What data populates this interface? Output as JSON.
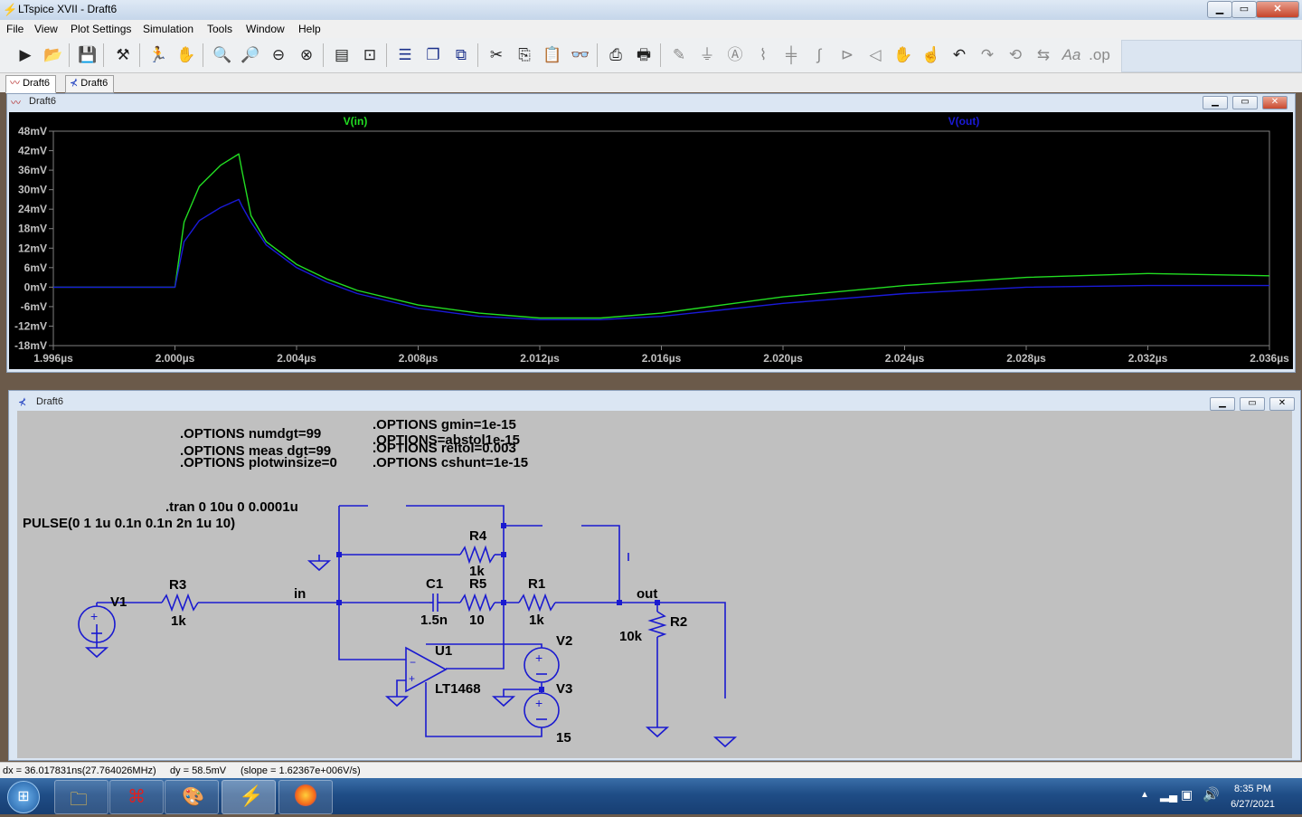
{
  "window": {
    "title": "LTspice XVII - Draft6",
    "min": "▁",
    "max": "▭",
    "close": "✕"
  },
  "menu": [
    "File",
    "View",
    "Plot Settings",
    "Simulation",
    "Tools",
    "Window",
    "Help"
  ],
  "toolbar_icons": [
    "run-icon",
    "open-icon",
    "save-icon",
    "control-panel-icon",
    "halt-icon",
    "pan-icon",
    "zoom-in-icon",
    "zoom-area-icon",
    "zoom-out-icon",
    "zoom-fit-icon",
    "autorange-icon",
    "mark-icon",
    "tile-horizontal-icon",
    "tile-vertical-icon",
    "cascade-icon",
    "cut-icon",
    "copy-icon",
    "paste-icon",
    "find-icon",
    "print-icon",
    "print-setup-icon",
    "wire-icon",
    "ground-icon",
    "label-icon",
    "resistor-icon",
    "capacitor-icon",
    "inductor-icon",
    "diode-icon",
    "component-icon",
    "move-icon",
    "drag-icon",
    "undo-icon",
    "redo-icon",
    "rotate-icon",
    "mirror-icon",
    "text-icon",
    "spice-directive-icon"
  ],
  "tabs": [
    {
      "label": "Draft6",
      "active": true
    },
    {
      "label": "Draft6",
      "active": false
    }
  ],
  "plot_window": {
    "title": "Draft6"
  },
  "schematic_window": {
    "title": "Draft6"
  },
  "chart_data": {
    "type": "line",
    "title": "",
    "xlabel": "",
    "ylabel": "",
    "background": "#000000",
    "xlim_us": [
      1.996,
      2.036
    ],
    "ylim_mV": [
      -18,
      48
    ],
    "x_ticks": [
      "1.996µs",
      "2.000µs",
      "2.004µs",
      "2.008µs",
      "2.012µs",
      "2.016µs",
      "2.020µs",
      "2.024µs",
      "2.028µs",
      "2.032µs",
      "2.036µs"
    ],
    "y_ticks": [
      "48mV",
      "42mV",
      "36mV",
      "30mV",
      "24mV",
      "18mV",
      "12mV",
      "6mV",
      "0mV",
      "-6mV",
      "-12mV",
      "-18mV"
    ],
    "series": [
      {
        "name": "V(in)",
        "color": "#22dd22",
        "x": [
          1.996,
          2.0,
          2.0003,
          2.0008,
          2.0015,
          2.0021,
          2.0022,
          2.0025,
          2.003,
          2.004,
          2.005,
          2.006,
          2.008,
          2.01,
          2.012,
          2.014,
          2.016,
          2.018,
          2.02,
          2.024,
          2.028,
          2.032,
          2.036
        ],
        "y": [
          0,
          0,
          20,
          31,
          37.5,
          41,
          36,
          22,
          14,
          7,
          2.5,
          -1,
          -5.5,
          -8,
          -9.5,
          -9.5,
          -8,
          -5.5,
          -3,
          0.5,
          3,
          4.2,
          3.5
        ]
      },
      {
        "name": "V(out)",
        "color": "#1a1ad8",
        "x": [
          1.996,
          2.0,
          2.0003,
          2.0008,
          2.0015,
          2.0021,
          2.0022,
          2.0025,
          2.003,
          2.004,
          2.005,
          2.006,
          2.008,
          2.01,
          2.012,
          2.014,
          2.016,
          2.018,
          2.02,
          2.024,
          2.028,
          2.032,
          2.036
        ],
        "y": [
          0,
          0,
          14,
          20.5,
          24.5,
          27,
          25,
          20,
          13,
          6,
          1.5,
          -2,
          -6.5,
          -9,
          -10,
          -10,
          -9,
          -7,
          -5,
          -2,
          0,
          0.5,
          0.5
        ]
      }
    ]
  },
  "schematic": {
    "directives": [
      ".OPTIONS numdgt=99",
      ".OPTIONS meas dgt=99",
      ".OPTIONS plotwinsize=0",
      ".OPTIONS gmin=1e-15",
      ".OPTIONS=abstol1e-15",
      ".OPTIONS reltol=0.003",
      ".OPTIONS cshunt=1e-15",
      ".tran 0 10u 0 0.0001u",
      "PULSE(0 1 1u 0.1n 0.1n 2n 1u 10)"
    ],
    "labels": {
      "v1": "V1",
      "r3": "R3",
      "r3_val": "1k",
      "net_in": "in",
      "c1": "C1",
      "c1_val": "1.5n",
      "r5": "R5",
      "r5_val": "10",
      "r4": "R4",
      "r4_val": "1k",
      "r1": "R1",
      "r1_val": "1k",
      "net_out": "out",
      "r2": "R2",
      "r2_val": "10k",
      "u1": "U1",
      "u1_part": "LT1468",
      "v2": "V2",
      "v3_overlap": "V3",
      "v15": "15"
    }
  },
  "status": {
    "dx": "dx = 36.017831ns(27.764026MHz)",
    "dy": "dy = 58.5mV",
    "slope": "(slope = 1.62367e+006V/s)"
  },
  "clock": {
    "time": "8:35 PM",
    "date": "6/27/2021"
  }
}
